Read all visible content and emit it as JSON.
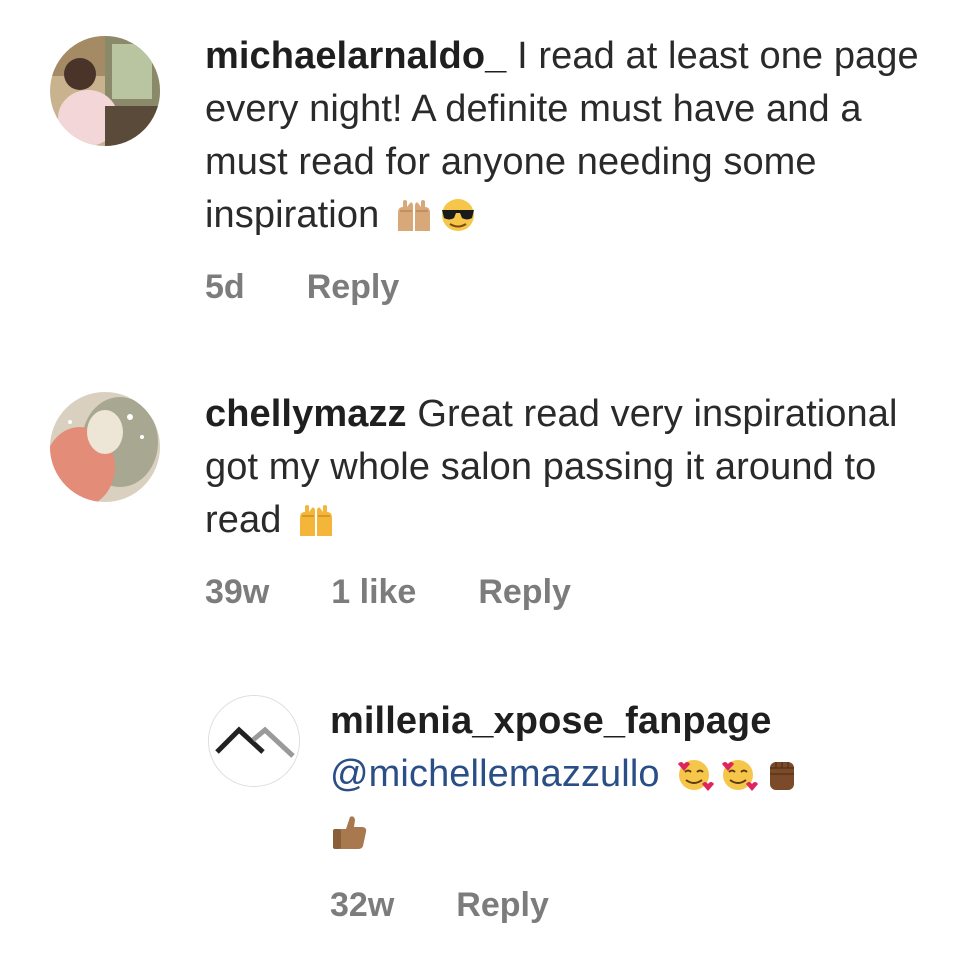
{
  "comments": [
    {
      "username": "michaelarnaldo_",
      "text": " I read at least one page every night! A definite must have and a must read for anyone needing some inspiration",
      "emojis": [
        "raising-hands-light-skin",
        "smiling-face-with-sunglasses"
      ],
      "time": "5d",
      "reply_label": "Reply"
    },
    {
      "username": "chellymazz",
      "text": " Great read very inspirational got my whole salon passing it around to read",
      "emojis": [
        "raising-hands"
      ],
      "time": "39w",
      "likes": "1 like",
      "reply_label": "Reply"
    },
    {
      "username": "millenia_xpose_fanpage",
      "mention": "@michellemazzullo",
      "emojis": [
        "smiling-face-with-hearts",
        "smiling-face-with-hearts",
        "raised-fist-dark",
        "thumbs-up-medium"
      ],
      "time": "32w",
      "reply_label": "Reply"
    }
  ],
  "colors": {
    "text": "#2a2a2a",
    "meta": "#7c7c7c",
    "mention": "#2a4f86"
  }
}
